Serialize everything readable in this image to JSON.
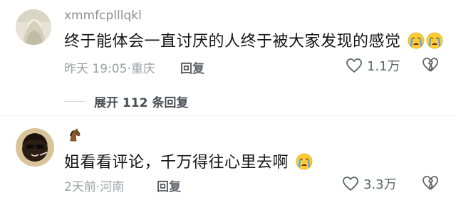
{
  "comments": [
    {
      "username": "xmmfcplllqkl",
      "text": "终于能体会一直讨厌的人终于被大家发现的感觉",
      "emojis": [
        "crying-face",
        "crying-face"
      ],
      "time": "昨天 19:05",
      "location": "重庆",
      "reply_label": "回复",
      "likes": "1.1万"
    },
    {
      "username": "",
      "username_icon": "horse-emoji",
      "text": "姐看看评论，千万得往心里去啊",
      "emojis": [
        "crying-face"
      ],
      "time": "2天前",
      "location": "河南",
      "reply_label": "回复",
      "likes": "3.3万"
    }
  ],
  "expand_replies": "展开 112 条回复",
  "colors": {
    "secondary_text": "#9aa0a6",
    "primary_text": "#151515",
    "icon_gray": "#5f6368"
  }
}
